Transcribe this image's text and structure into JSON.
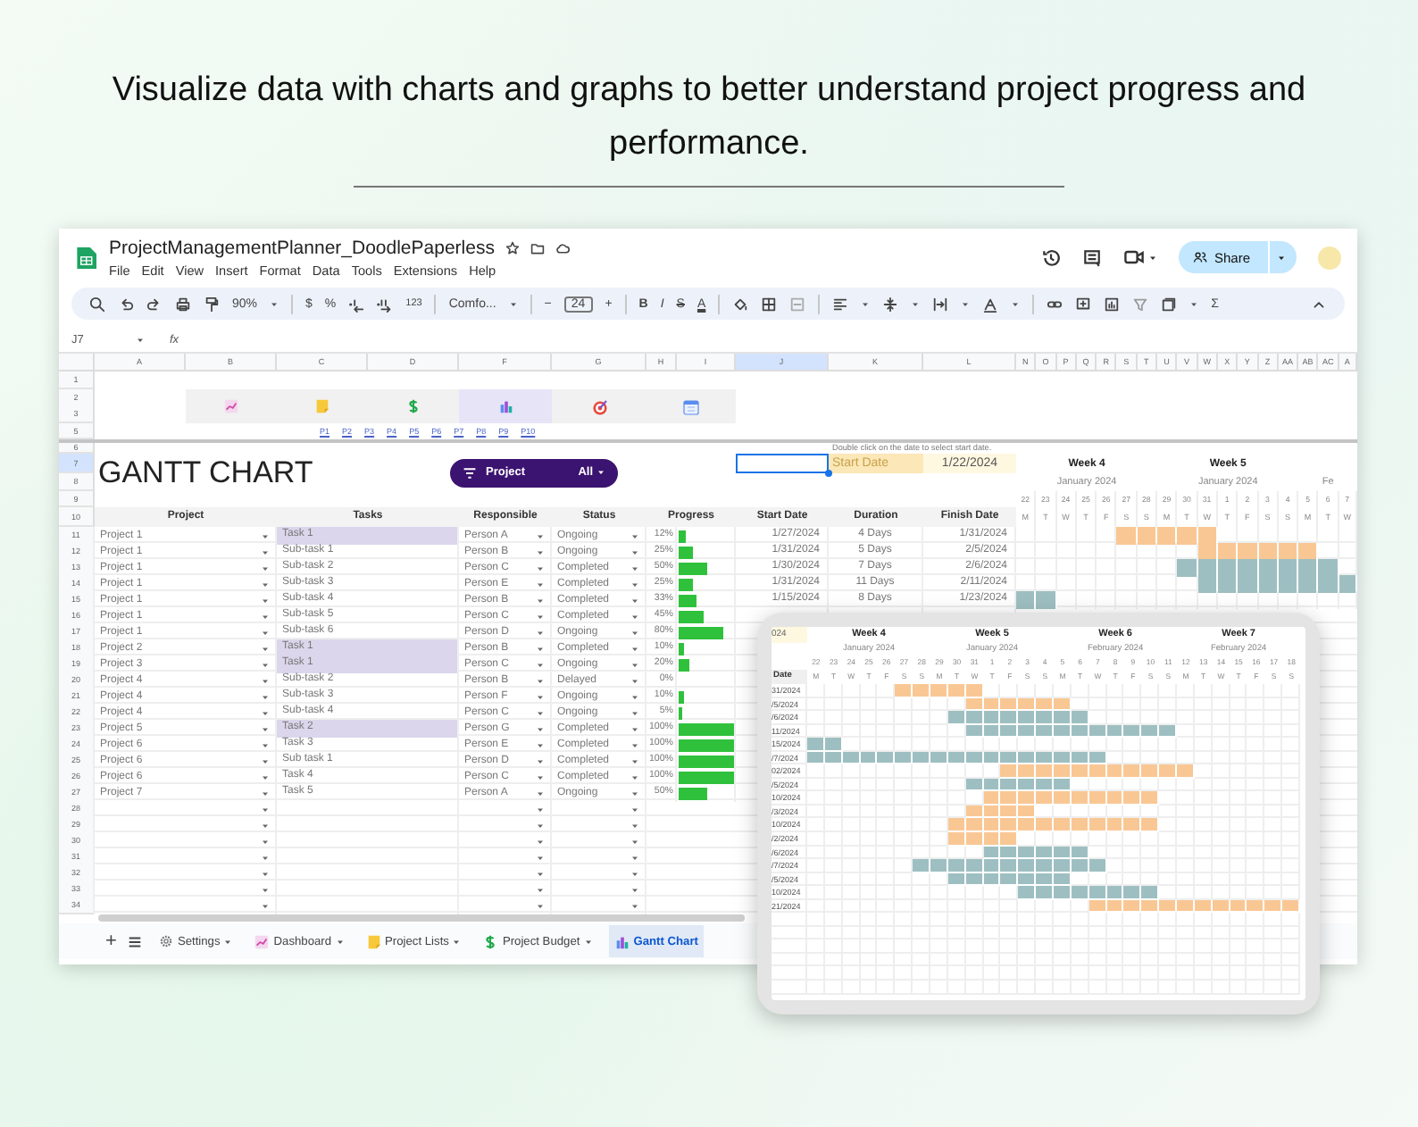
{
  "headline": "Visualize data with charts and graphs to better understand project progress and performance.",
  "window": {
    "title": "ProjectManagementPlanner_DoodlePaperless",
    "menu": [
      "File",
      "Edit",
      "View",
      "Insert",
      "Format",
      "Data",
      "Tools",
      "Extensions",
      "Help"
    ],
    "share": "Share"
  },
  "toolbar": {
    "zoom": "90%",
    "currency": "$",
    "percent": "%",
    "number_format": "123",
    "font": "Comfo...",
    "font_minus": "−",
    "font_size": "24",
    "font_plus": "+",
    "bold": "B",
    "italic": "I",
    "strikethrough": "S",
    "text_color": "A",
    "sum": "Σ"
  },
  "formula_bar": {
    "cell": "J7",
    "fx": "fx"
  },
  "column_headers": [
    {
      "label": "A",
      "selected": false
    },
    {
      "label": "B",
      "selected": false
    },
    {
      "label": "C",
      "selected": false
    },
    {
      "label": "D",
      "selected": false
    },
    {
      "label": "F",
      "selected": false
    },
    {
      "label": "G",
      "selected": false
    },
    {
      "label": "H",
      "selected": false
    },
    {
      "label": "I",
      "selected": false
    },
    {
      "label": "J",
      "selected": true
    },
    {
      "label": "K",
      "selected": false
    },
    {
      "label": "L",
      "selected": false
    },
    {
      "label": "N",
      "selected": false
    },
    {
      "label": "O",
      "selected": false
    },
    {
      "label": "P",
      "selected": false
    },
    {
      "label": "Q",
      "selected": false
    },
    {
      "label": "R",
      "selected": false
    },
    {
      "label": "S",
      "selected": false
    },
    {
      "label": "T",
      "selected": false
    },
    {
      "label": "U",
      "selected": false
    },
    {
      "label": "V",
      "selected": false
    },
    {
      "label": "W",
      "selected": false
    },
    {
      "label": "X",
      "selected": false
    },
    {
      "label": "Y",
      "selected": false
    },
    {
      "label": "Z",
      "selected": false
    },
    {
      "label": "AA",
      "selected": false
    },
    {
      "label": "AB",
      "selected": false
    },
    {
      "label": "AC",
      "selected": false
    },
    {
      "label": "A",
      "selected": false
    }
  ],
  "row_headers_top": [
    {
      "label": "1",
      "selected": false
    },
    {
      "label": "2",
      "selected": false
    },
    {
      "label": "3",
      "selected": false
    },
    {
      "label": "5",
      "selected": false
    },
    {
      "label": "6",
      "selected": false
    },
    {
      "label": "7",
      "selected": true
    },
    {
      "label": "8",
      "selected": false
    },
    {
      "label": "9",
      "selected": false
    },
    {
      "label": "10",
      "selected": false
    }
  ],
  "nav_buttons": [
    {
      "selected": false
    },
    {
      "selected": false
    },
    {
      "selected": false
    },
    {
      "selected": true
    },
    {
      "selected": false
    },
    {
      "selected": false
    }
  ],
  "page_links": [
    "P1",
    "P2",
    "P3",
    "P4",
    "P5",
    "P6",
    "P7",
    "P8",
    "P9",
    "P10"
  ],
  "note": "Double click on the date to select start date.",
  "title": "GANTT CHART",
  "filter": {
    "label": "Project",
    "value": "All"
  },
  "start_date": {
    "label": "Start Date",
    "value": "1/22/2024"
  },
  "table_headers": {
    "project": "Project",
    "tasks": "Tasks",
    "responsible": "Responsible",
    "status": "Status",
    "progress": "Progress",
    "start": "Start Date",
    "duration": "Duration",
    "finish": "Finish Date"
  },
  "gantt_header": {
    "weeks": [
      {
        "week": "Week 4",
        "month": "January 2024"
      },
      {
        "week": "Week 5",
        "month": "January 2024"
      },
      {
        "month": "Fe"
      }
    ],
    "days": [
      "22",
      "23",
      "24",
      "25",
      "26",
      "27",
      "28",
      "29",
      "30",
      "31",
      "1",
      "2",
      "3",
      "4",
      "5",
      "6",
      "7"
    ],
    "weekdays": [
      "M",
      "T",
      "W",
      "T",
      "F",
      "S",
      "S",
      "M",
      "T",
      "W",
      "T",
      "F",
      "S",
      "S",
      "M",
      "T",
      "W"
    ]
  },
  "rows": [
    {
      "row": "11",
      "project": "Project 1",
      "task": "Task 1",
      "highlighted": true,
      "responsible": "Person A",
      "status": "Ongoing",
      "progress": "12%",
      "level": 0.12,
      "start": "1/27/2024",
      "duration": "4 Days",
      "finish": "1/31/2024",
      "gantt": {
        "color": "#f9c794",
        "cells": [
          false,
          false,
          false,
          false,
          false,
          true,
          true,
          true,
          true,
          true,
          false,
          false,
          false,
          false,
          false,
          false,
          false
        ]
      }
    },
    {
      "row": "12",
      "project": "Project 1",
      "task": "Sub-task 1",
      "highlighted": false,
      "responsible": "Person B",
      "status": "Ongoing",
      "progress": "25%",
      "level": 0.25,
      "start": "1/31/2024",
      "duration": "5 Days",
      "finish": "2/5/2024",
      "gantt": {
        "color": "#f9c794",
        "cells": [
          false,
          false,
          false,
          false,
          false,
          false,
          false,
          false,
          false,
          true,
          true,
          true,
          true,
          true,
          true,
          false,
          false
        ]
      }
    },
    {
      "row": "13",
      "project": "Project 1",
      "task": "Sub-task 2",
      "highlighted": false,
      "responsible": "Person C",
      "status": "Completed",
      "progress": "50%",
      "level": 0.5,
      "start": "1/30/2024",
      "duration": "7 Days",
      "finish": "2/6/2024",
      "gantt": {
        "color": "#9ebfc2",
        "cells": [
          false,
          false,
          false,
          false,
          false,
          false,
          false,
          false,
          true,
          true,
          true,
          true,
          true,
          true,
          true,
          true,
          false
        ]
      }
    },
    {
      "row": "14",
      "project": "Project 1",
      "task": "Sub-task 3",
      "highlighted": false,
      "responsible": "Person E",
      "status": "Completed",
      "progress": "25%",
      "level": 0.25,
      "start": "1/31/2024",
      "duration": "11 Days",
      "finish": "2/11/2024",
      "gantt": {
        "color": "#9ebfc2",
        "cells": [
          false,
          false,
          false,
          false,
          false,
          false,
          false,
          false,
          false,
          true,
          true,
          true,
          true,
          true,
          true,
          true,
          true
        ]
      }
    },
    {
      "row": "15",
      "project": "Project 1",
      "task": "Sub-task 4",
      "highlighted": false,
      "responsible": "Person B",
      "status": "Completed",
      "progress": "33%",
      "level": 0.33,
      "start": "1/15/2024",
      "duration": "8 Days",
      "finish": "1/23/2024",
      "gantt": {
        "color": "#9ebfc2",
        "cells": [
          true,
          true,
          false,
          false,
          false,
          false,
          false,
          false,
          false,
          false,
          false,
          false,
          false,
          false,
          false,
          false,
          false
        ]
      }
    },
    {
      "row": "16",
      "project": "Project 1",
      "task": "Sub-task 5",
      "highlighted": false,
      "responsible": "Person C",
      "status": "Completed",
      "progress": "45%",
      "level": 0.45
    },
    {
      "row": "17",
      "project": "Project 1",
      "task": "Sub-task 6",
      "highlighted": false,
      "responsible": "Person D",
      "status": "Ongoing",
      "progress": "80%",
      "level": 0.8
    },
    {
      "row": "18",
      "project": "Project 2",
      "task": "Task 1",
      "highlighted": true,
      "responsible": "Person B",
      "status": "Completed",
      "progress": "10%",
      "level": 0.1
    },
    {
      "row": "19",
      "project": "Project 3",
      "task": "Task 1",
      "highlighted": true,
      "responsible": "Person C",
      "status": "Ongoing",
      "progress": "20%",
      "level": 0.2
    },
    {
      "row": "20",
      "project": "Project 4",
      "task": "Sub-task 2",
      "highlighted": false,
      "responsible": "Person B",
      "status": "Delayed",
      "progress": "0%",
      "level": 0
    },
    {
      "row": "21",
      "project": "Project 4",
      "task": "Sub-task 3",
      "highlighted": false,
      "responsible": "Person F",
      "status": "Ongoing",
      "progress": "10%",
      "level": 0.1
    },
    {
      "row": "22",
      "project": "Project 4",
      "task": "Sub-task 4",
      "highlighted": false,
      "responsible": "Person C",
      "status": "Ongoing",
      "progress": "5%",
      "level": 0.05
    },
    {
      "row": "23",
      "project": "Project 5",
      "task": "Task 2",
      "highlighted": true,
      "responsible": "Person G",
      "status": "Completed",
      "progress": "100%",
      "level": 1
    },
    {
      "row": "24",
      "project": "Project 6",
      "task": "Task 3",
      "highlighted": false,
      "responsible": "Person E",
      "status": "Completed",
      "progress": "100%",
      "level": 1
    },
    {
      "row": "25",
      "project": "Project 6",
      "task": "Sub task 1",
      "highlighted": false,
      "responsible": "Person D",
      "status": "Completed",
      "progress": "100%",
      "level": 1
    },
    {
      "row": "26",
      "project": "Project 6",
      "task": "Task 4",
      "highlighted": false,
      "responsible": "Person C",
      "status": "Completed",
      "progress": "100%",
      "level": 1
    },
    {
      "row": "27",
      "project": "Project 7",
      "task": "Task 5",
      "highlighted": false,
      "responsible": "Person A",
      "status": "Ongoing",
      "progress": "50%",
      "level": 0.5
    }
  ],
  "empty_rows": [
    "28",
    "29",
    "30",
    "31",
    "32",
    "33",
    "34"
  ],
  "add_sheet": "+",
  "sheet_tabs": [
    {
      "label": "Settings",
      "selected": false
    },
    {
      "label": "Dashboard",
      "selected": false
    },
    {
      "label": "Project Lists",
      "selected": false
    },
    {
      "label": "Project Budget",
      "selected": false
    },
    {
      "label": "Gantt Chart",
      "selected": true
    }
  ],
  "tablet": {
    "year": "024",
    "date_label": "Date",
    "weeks": [
      {
        "week": "Week 4",
        "month": "January 2024"
      },
      {
        "week": "Week 5",
        "month": "January 2024"
      },
      {
        "week": "Week 6",
        "month": "February 2024"
      },
      {
        "week": "Week 7",
        "month": "February 2024"
      }
    ],
    "days": [
      "22",
      "23",
      "24",
      "25",
      "26",
      "27",
      "28",
      "29",
      "30",
      "31",
      "1",
      "2",
      "3",
      "4",
      "5",
      "6",
      "7",
      "8",
      "9",
      "10",
      "11",
      "12",
      "13",
      "14",
      "15",
      "16",
      "17",
      "18"
    ],
    "weekdays": [
      "M",
      "T",
      "W",
      "T",
      "F",
      "S",
      "S",
      "M",
      "T",
      "W",
      "T",
      "F",
      "S",
      "S",
      "M",
      "T",
      "W",
      "T",
      "F",
      "S",
      "S",
      "M",
      "T",
      "W",
      "T",
      "F",
      "S",
      "S"
    ],
    "rows": [
      {
        "date": "31/2024",
        "color": "#f9c794",
        "cells": [
          false,
          false,
          false,
          false,
          false,
          true,
          true,
          true,
          true,
          true,
          false,
          false,
          false,
          false,
          false,
          false,
          false,
          false,
          false,
          false,
          false,
          false,
          false,
          false,
          false,
          false,
          false,
          false
        ]
      },
      {
        "date": "/5/2024",
        "color": "#f9c794",
        "cells": [
          false,
          false,
          false,
          false,
          false,
          false,
          false,
          false,
          false,
          true,
          true,
          true,
          true,
          true,
          true,
          false,
          false,
          false,
          false,
          false,
          false,
          false,
          false,
          false,
          false,
          false,
          false,
          false
        ]
      },
      {
        "date": "/6/2024",
        "color": "#9ebfc2",
        "cells": [
          false,
          false,
          false,
          false,
          false,
          false,
          false,
          false,
          true,
          true,
          true,
          true,
          true,
          true,
          true,
          true,
          false,
          false,
          false,
          false,
          false,
          false,
          false,
          false,
          false,
          false,
          false,
          false
        ]
      },
      {
        "date": "11/2024",
        "color": "#9ebfc2",
        "cells": [
          false,
          false,
          false,
          false,
          false,
          false,
          false,
          false,
          false,
          true,
          true,
          true,
          true,
          true,
          true,
          true,
          true,
          true,
          true,
          true,
          true,
          false,
          false,
          false,
          false,
          false,
          false,
          false
        ]
      },
      {
        "date": "15/2024",
        "color": "#9ebfc2",
        "cells": [
          true,
          true,
          false,
          false,
          false,
          false,
          false,
          false,
          false,
          false,
          false,
          false,
          false,
          false,
          false,
          false,
          false,
          false,
          false,
          false,
          false,
          false,
          false,
          false,
          false,
          false,
          false,
          false
        ]
      },
      {
        "date": "/7/2024",
        "color": "#9ebfc2",
        "cells": [
          true,
          true,
          true,
          true,
          true,
          true,
          true,
          true,
          true,
          true,
          true,
          true,
          true,
          true,
          true,
          true,
          true,
          false,
          false,
          false,
          false,
          false,
          false,
          false,
          false,
          false,
          false,
          false
        ]
      },
      {
        "date": "02/2024",
        "color": "#f9c794",
        "cells": [
          false,
          false,
          false,
          false,
          false,
          false,
          false,
          false,
          false,
          false,
          false,
          true,
          true,
          true,
          true,
          true,
          true,
          true,
          true,
          true,
          true,
          true,
          false,
          false,
          false,
          false,
          false,
          false
        ]
      },
      {
        "date": "/5/2024",
        "color": "#9ebfc2",
        "cells": [
          false,
          false,
          false,
          false,
          false,
          false,
          false,
          false,
          false,
          true,
          true,
          true,
          true,
          true,
          true,
          false,
          false,
          false,
          false,
          false,
          false,
          false,
          false,
          false,
          false,
          false,
          false,
          false
        ]
      },
      {
        "date": "10/2024",
        "color": "#f9c794",
        "cells": [
          false,
          false,
          false,
          false,
          false,
          false,
          false,
          false,
          false,
          false,
          true,
          true,
          true,
          true,
          true,
          true,
          true,
          true,
          true,
          true,
          false,
          false,
          false,
          false,
          false,
          false,
          false,
          false
        ]
      },
      {
        "date": "/3/2024",
        "color": "#f9c794",
        "cells": [
          false,
          false,
          false,
          false,
          false,
          false,
          false,
          false,
          false,
          true,
          true,
          true,
          true,
          false,
          false,
          false,
          false,
          false,
          false,
          false,
          false,
          false,
          false,
          false,
          false,
          false,
          false,
          false
        ]
      },
      {
        "date": "10/2024",
        "color": "#f9c794",
        "cells": [
          false,
          false,
          false,
          false,
          false,
          false,
          false,
          false,
          true,
          true,
          true,
          true,
          true,
          true,
          true,
          true,
          true,
          true,
          true,
          true,
          false,
          false,
          false,
          false,
          false,
          false,
          false,
          false
        ]
      },
      {
        "date": "/2/2024",
        "color": "#f9c794",
        "cells": [
          false,
          false,
          false,
          false,
          false,
          false,
          false,
          false,
          true,
          true,
          true,
          true,
          false,
          false,
          false,
          false,
          false,
          false,
          false,
          false,
          false,
          false,
          false,
          false,
          false,
          false,
          false,
          false
        ]
      },
      {
        "date": "/6/2024",
        "color": "#9ebfc2",
        "cells": [
          false,
          false,
          false,
          false,
          false,
          false,
          false,
          false,
          false,
          false,
          true,
          true,
          true,
          true,
          true,
          true,
          false,
          false,
          false,
          false,
          false,
          false,
          false,
          false,
          false,
          false,
          false,
          false
        ]
      },
      {
        "date": "/7/2024",
        "color": "#9ebfc2",
        "cells": [
          false,
          false,
          false,
          false,
          false,
          false,
          true,
          true,
          true,
          true,
          true,
          true,
          true,
          true,
          true,
          true,
          true,
          false,
          false,
          false,
          false,
          false,
          false,
          false,
          false,
          false,
          false,
          false
        ]
      },
      {
        "date": "/5/2024",
        "color": "#9ebfc2",
        "cells": [
          false,
          false,
          false,
          false,
          false,
          false,
          false,
          false,
          true,
          true,
          true,
          true,
          true,
          true,
          true,
          false,
          false,
          false,
          false,
          false,
          false,
          false,
          false,
          false,
          false,
          false,
          false,
          false
        ]
      },
      {
        "date": "10/2024",
        "color": "#9ebfc2",
        "cells": [
          false,
          false,
          false,
          false,
          false,
          false,
          false,
          false,
          false,
          false,
          false,
          false,
          true,
          true,
          true,
          true,
          true,
          true,
          true,
          true,
          false,
          false,
          false,
          false,
          false,
          false,
          false,
          false
        ]
      },
      {
        "date": "21/2024",
        "color": "#f9c794",
        "cells": [
          false,
          false,
          false,
          false,
          false,
          false,
          false,
          false,
          false,
          false,
          false,
          false,
          false,
          false,
          false,
          false,
          true,
          true,
          true,
          true,
          true,
          true,
          true,
          true,
          true,
          true,
          true,
          true
        ]
      }
    ]
  }
}
